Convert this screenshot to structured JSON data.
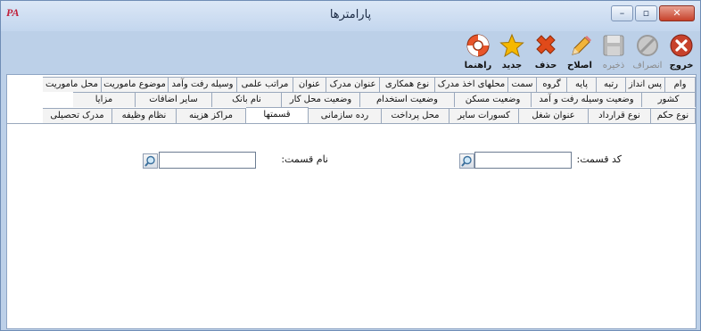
{
  "window": {
    "title": "پارامترها",
    "logo": "PA",
    "min_icon": "minimize-icon",
    "max_icon": "maximize-icon",
    "close_icon": "close-icon"
  },
  "toolbar": [
    {
      "key": "exit",
      "label": "خروج",
      "icon": "exit-icon",
      "enabled": true
    },
    {
      "key": "cancel",
      "label": "انصراف",
      "icon": "cancel-icon",
      "enabled": false
    },
    {
      "key": "save",
      "label": "ذخیره",
      "icon": "save-icon",
      "enabled": false
    },
    {
      "key": "edit",
      "label": "اصلاح",
      "icon": "pencil-icon",
      "enabled": true
    },
    {
      "key": "delete",
      "label": "حذف",
      "icon": "delete-icon",
      "enabled": true
    },
    {
      "key": "new",
      "label": "جدید",
      "icon": "star-icon",
      "enabled": true
    },
    {
      "key": "help",
      "label": "راهنما",
      "icon": "lifebuoy-icon",
      "enabled": true
    }
  ],
  "tabs": {
    "row1": [
      "وام",
      "پس انداز",
      "رتبه",
      "پایه",
      "گروه",
      "سمت",
      "محلهای اخذ مدرک",
      "نوع همکاری",
      "عنوان مدرک",
      "عنوان",
      "مراتب علمی",
      "وسیله رفت وآمد",
      "موضوع ماموریت",
      "محل ماموریت"
    ],
    "row2": [
      "کشور",
      "وضعیت وسیله رفت و آمد",
      "وضعیت مسکن",
      "وضعیت استخدام",
      "وضعیت محل کار",
      "نام بانک",
      "سایر اضافات",
      "مزایا"
    ],
    "row3": [
      "نوع حکم",
      "نوع قرارداد",
      "عنوان شغل",
      "کسورات سایر",
      "محل پرداخت",
      "رده سازمانی",
      "قسمتها",
      "مراکز هزینه",
      "نظام وظیفه",
      "مدرک تحصیلی"
    ],
    "active": "قسمتها"
  },
  "form": {
    "code_label": "کد قسمت:",
    "code_value": "",
    "name_label": "نام قسمت:",
    "name_value": "",
    "lookup_icon": "magnifier-icon"
  },
  "colors": {
    "frame": "#bcd0e8",
    "close": "#c7412b",
    "delete": "#e04a1a",
    "star": "#f5b800",
    "help": "#e8552a"
  }
}
